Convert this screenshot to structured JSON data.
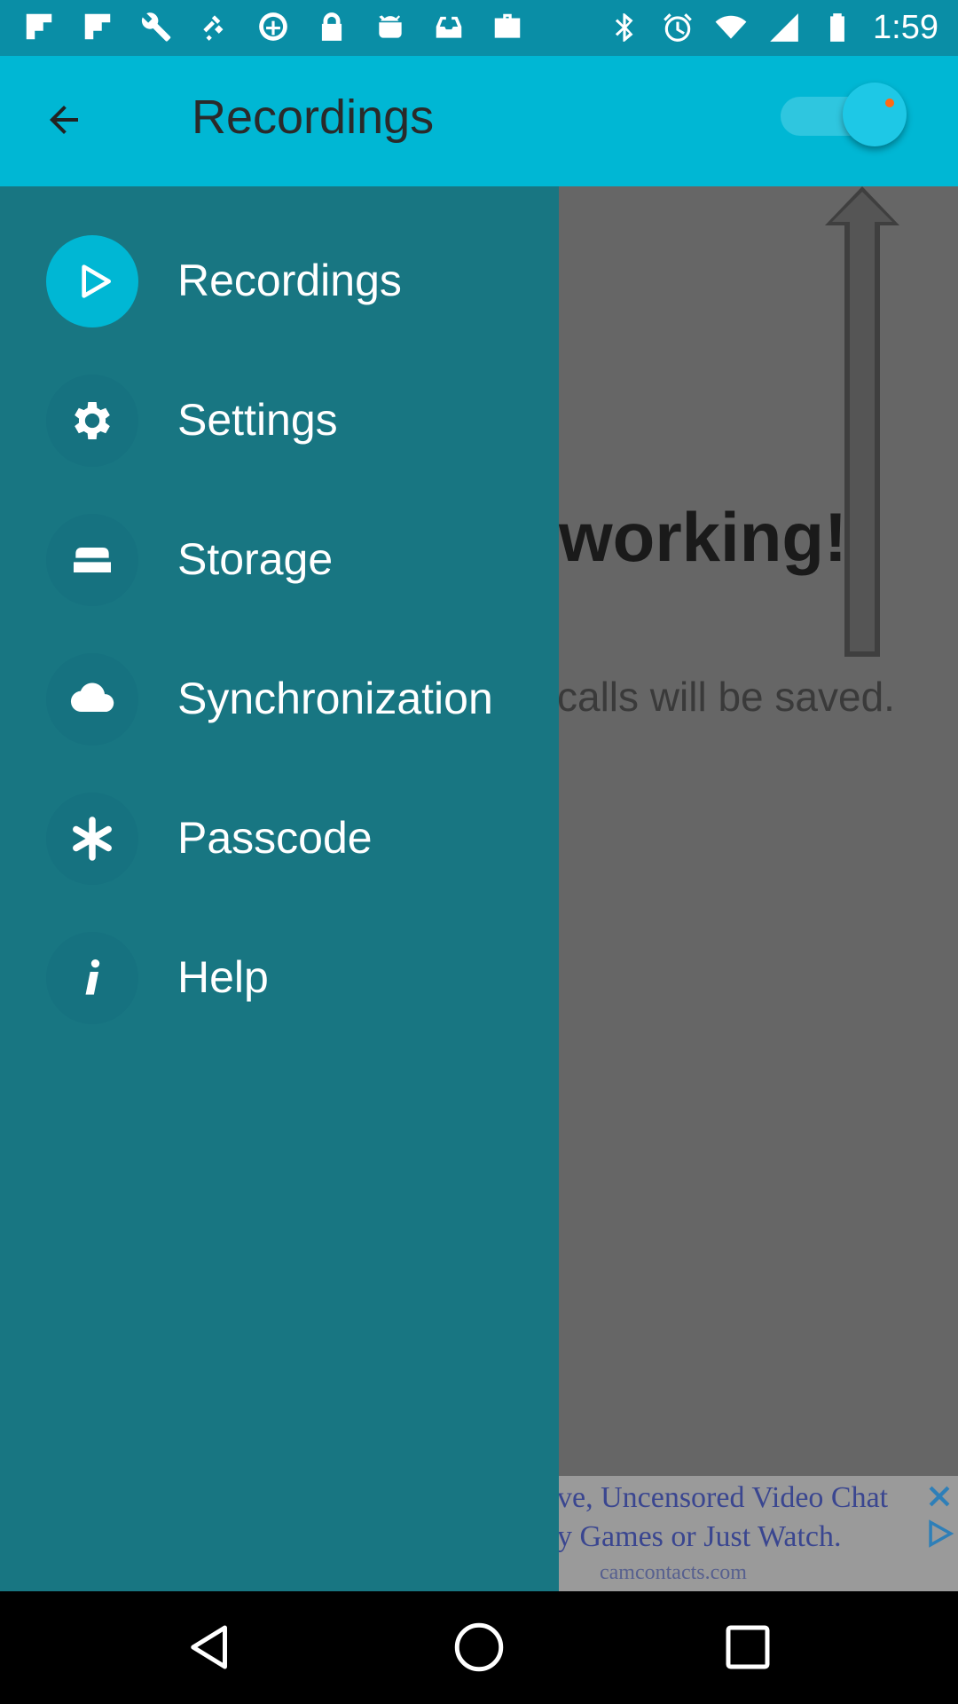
{
  "status_bar": {
    "time": "1:59",
    "left_icons": [
      "flipboard-icon",
      "flipboard-icon",
      "wrench-icon",
      "fake-gps-icon",
      "data-saver-icon",
      "lock-icon",
      "android-icon",
      "inbox-icon",
      "briefcase-icon"
    ],
    "right_icons": [
      "bluetooth-icon",
      "alarm-icon",
      "wifi-icon",
      "signal-icon",
      "battery-icon"
    ]
  },
  "app_bar": {
    "title": "Recordings",
    "toggle_on": true,
    "color": "#00b7d4"
  },
  "background": {
    "heading": "working!",
    "subtext": "calls will be saved."
  },
  "ad": {
    "line1": "ve, Uncensored Video Chat",
    "line2": "y Games or Just Watch.",
    "domain": "camcontacts.com"
  },
  "drawer": {
    "items": [
      {
        "label": "Recordings",
        "icon": "play-icon",
        "active": true
      },
      {
        "label": "Settings",
        "icon": "gear-icon",
        "active": false
      },
      {
        "label": "Storage",
        "icon": "storage-icon",
        "active": false
      },
      {
        "label": "Synchronization",
        "icon": "cloud-icon",
        "active": false
      },
      {
        "label": "Passcode",
        "icon": "asterisk-icon",
        "active": false
      },
      {
        "label": "Help",
        "icon": "info-icon",
        "active": false
      }
    ],
    "color": "#187682"
  }
}
